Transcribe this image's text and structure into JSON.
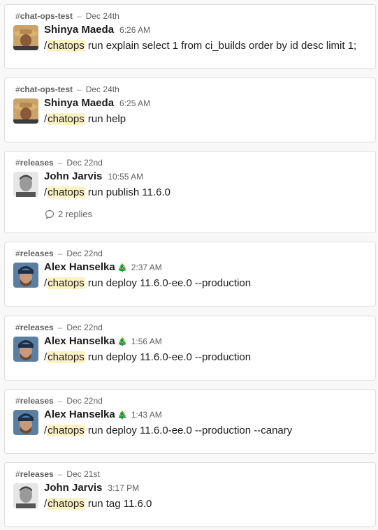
{
  "colors": {
    "highlight": "#fdf2c3",
    "card_border": "#dddddd",
    "muted": "#616061"
  },
  "icons": {
    "channel": "hash-icon",
    "reply": "comment-icon",
    "badge": "christmas-tree-icon"
  },
  "results": [
    {
      "hash": "#",
      "channel": "chat-ops-test",
      "sep": "–",
      "date": "Dec 24th",
      "author": "Shinya Maeda",
      "badge": "",
      "time": "6:26 AM",
      "slash": "/",
      "keyword": "chatops",
      "text": " run explain select 1 from ci_builds order by id desc limit 1;",
      "replies": ""
    },
    {
      "hash": "#",
      "channel": "chat-ops-test",
      "sep": "–",
      "date": "Dec 24th",
      "author": "Shinya Maeda",
      "badge": "",
      "time": "6:25 AM",
      "slash": "/",
      "keyword": "chatops",
      "text": " run help",
      "replies": ""
    },
    {
      "hash": "#",
      "channel": "releases",
      "sep": "–",
      "date": "Dec 22nd",
      "author": "John Jarvis",
      "badge": "",
      "time": "10:55 AM",
      "slash": "/",
      "keyword": "chatops",
      "text": " run publish 11.6.0",
      "replies": "2 replies"
    },
    {
      "hash": "#",
      "channel": "releases",
      "sep": "–",
      "date": "Dec 22nd",
      "author": "Alex Hanselka",
      "badge": "🎄",
      "time": "2:37 AM",
      "slash": "/",
      "keyword": "chatops",
      "text": " run deploy 11.6.0-ee.0 --production",
      "replies": ""
    },
    {
      "hash": "#",
      "channel": "releases",
      "sep": "–",
      "date": "Dec 22nd",
      "author": "Alex Hanselka",
      "badge": "🎄",
      "time": "1:56 AM",
      "slash": "/",
      "keyword": "chatops",
      "text": " run deploy 11.6.0-ee.0 --production",
      "replies": ""
    },
    {
      "hash": "#",
      "channel": "releases",
      "sep": "–",
      "date": "Dec 22nd",
      "author": "Alex Hanselka",
      "badge": "🎄",
      "time": "1:43 AM",
      "slash": "/",
      "keyword": "chatops",
      "text": " run deploy 11.6.0-ee.0 --production --canary",
      "replies": ""
    },
    {
      "hash": "#",
      "channel": "releases",
      "sep": "–",
      "date": "Dec 21st",
      "author": "John Jarvis",
      "badge": "",
      "time": "3:17 PM",
      "slash": "/",
      "keyword": "chatops",
      "text": " run tag 11.6.0",
      "replies": ""
    }
  ]
}
